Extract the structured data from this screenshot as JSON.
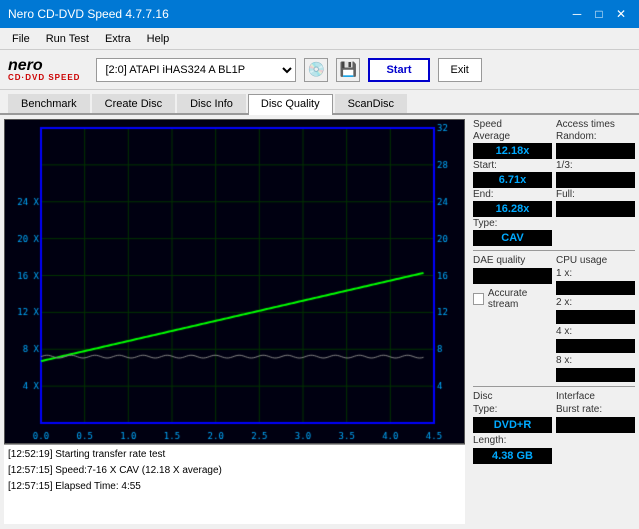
{
  "window": {
    "title": "Nero CD-DVD Speed 4.7.7.16"
  },
  "title_controls": {
    "minimize": "─",
    "maximize": "□",
    "close": "✕"
  },
  "menu": {
    "items": [
      "File",
      "Run Test",
      "Extra",
      "Help"
    ]
  },
  "toolbar": {
    "logo_nero": "nero",
    "logo_sub": "CD·DVD SPEED",
    "drive_value": "[2:0]  ATAPI iHAS324  A BL1P",
    "start_label": "Start",
    "exit_label": "Exit"
  },
  "tabs": {
    "items": [
      "Benchmark",
      "Create Disc",
      "Disc Info",
      "Disc Quality",
      "ScanDisc"
    ],
    "active": "Disc Quality"
  },
  "chart": {
    "x_labels": [
      "0.0",
      "0.5",
      "1.0",
      "1.5",
      "2.0",
      "2.5",
      "3.0",
      "3.5",
      "4.0",
      "4.5"
    ],
    "y_left_labels": [
      "4 X",
      "8 X",
      "12 X",
      "16 X",
      "20 X",
      "24 X"
    ],
    "y_right_labels": [
      "4",
      "8",
      "12",
      "16",
      "20",
      "24",
      "28",
      "32"
    ],
    "grid_color": "#003300",
    "line_color": "#00ff00",
    "border_color": "#0000ff"
  },
  "stats": {
    "speed": {
      "title": "Speed",
      "average_label": "Average",
      "average_value": "12.18x",
      "start_label": "Start:",
      "start_value": "6.71x",
      "end_label": "End:",
      "end_value": "16.28x",
      "type_label": "Type:",
      "type_value": "CAV"
    },
    "access_times": {
      "title": "Access times",
      "random_label": "Random:",
      "random_value": "",
      "one_third_label": "1/3:",
      "one_third_value": "",
      "full_label": "Full:",
      "full_value": ""
    },
    "cpu_usage": {
      "title": "CPU usage",
      "one_x_label": "1 x:",
      "one_x_value": "",
      "two_x_label": "2 x:",
      "two_x_value": "",
      "four_x_label": "4 x:",
      "four_x_value": "",
      "eight_x_label": "8 x:",
      "eight_x_value": ""
    },
    "dae_quality": {
      "title": "DAE quality",
      "value": ""
    },
    "accurate_stream": {
      "title": "Accurate stream",
      "checked": false
    },
    "disc": {
      "type_title": "Disc",
      "type_label": "Type:",
      "type_value": "DVD+R",
      "length_label": "Length:",
      "length_value": "4.38 GB"
    },
    "interface": {
      "title": "Interface",
      "burst_label": "Burst rate:",
      "burst_value": ""
    }
  },
  "log": {
    "lines": [
      "[12:52:19]  Starting transfer rate test",
      "[12:57:15]  Speed:7-16 X CAV (12.18 X average)",
      "[12:57:15]  Elapsed Time: 4:55"
    ]
  }
}
